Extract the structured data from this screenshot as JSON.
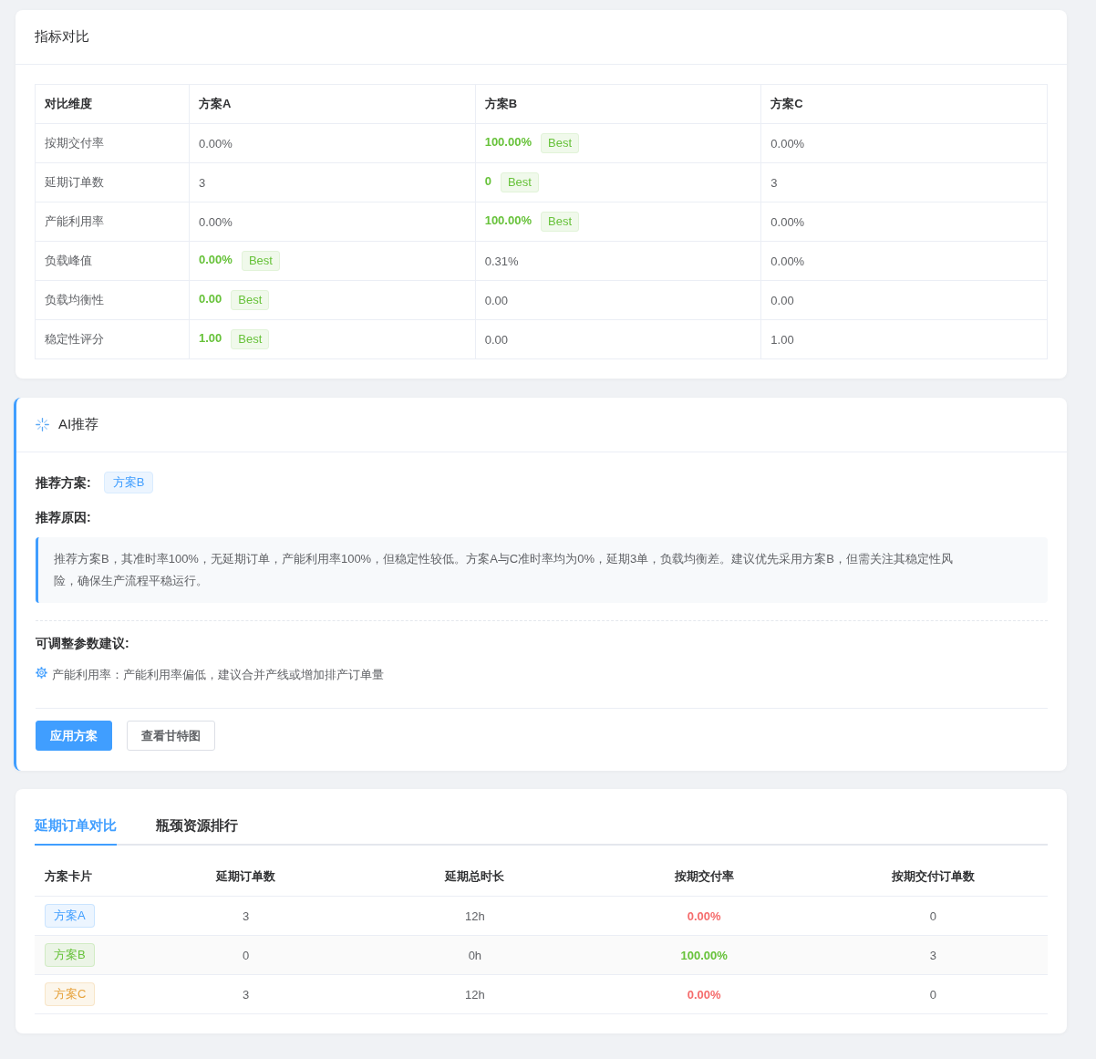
{
  "metrics": {
    "title": "指标对比",
    "dimension_header": "对比维度",
    "columns": [
      "方案A",
      "方案B",
      "方案C"
    ],
    "rows": [
      {
        "label": "按期交付率",
        "cells": [
          {
            "value": "0.00%",
            "best": false
          },
          {
            "value": "100.00%",
            "best": true,
            "badge": "Best"
          },
          {
            "value": "0.00%",
            "best": false
          }
        ]
      },
      {
        "label": "延期订单数",
        "cells": [
          {
            "value": "3",
            "best": false
          },
          {
            "value": "0",
            "best": true,
            "badge": "Best"
          },
          {
            "value": "3",
            "best": false
          }
        ]
      },
      {
        "label": "产能利用率",
        "cells": [
          {
            "value": "0.00%",
            "best": false
          },
          {
            "value": "100.00%",
            "best": true,
            "badge": "Best"
          },
          {
            "value": "0.00%",
            "best": false
          }
        ]
      },
      {
        "label": "负载峰值",
        "cells": [
          {
            "value": "0.00%",
            "best": true,
            "badge": "Best"
          },
          {
            "value": "0.31%",
            "best": false
          },
          {
            "value": "0.00%",
            "best": false
          }
        ]
      },
      {
        "label": "负载均衡性",
        "cells": [
          {
            "value": "0.00",
            "best": true,
            "badge": "Best"
          },
          {
            "value": "0.00",
            "best": false
          },
          {
            "value": "0.00",
            "best": false
          }
        ]
      },
      {
        "label": "稳定性评分",
        "cells": [
          {
            "value": "1.00",
            "best": true,
            "badge": "Best"
          },
          {
            "value": "0.00",
            "best": false
          },
          {
            "value": "1.00",
            "best": false
          }
        ]
      }
    ]
  },
  "ai_recommendation": {
    "title": "AI推荐",
    "recommended_label": "推荐方案:",
    "recommended_plan": "方案B",
    "reason_label": "推荐原因:",
    "reason": "推荐方案B，其准时率100%，无延期订单，产能利用率100%，但稳定性较低。方案A与C准时率均为0%，延期3单，负载均衡差。建议优先采用方案B，但需关注其稳定性风险，确保生产流程平稳运行。",
    "params_label": "可调整参数建议:",
    "params": [
      {
        "text": "产能利用率：产能利用率偏低，建议合并产线或增加排产订单量"
      }
    ],
    "buttons": [
      {
        "label": "应用方案",
        "kind": "primary"
      },
      {
        "label": "查看甘特图",
        "kind": "default"
      }
    ]
  },
  "delay_comparison": {
    "tabs": [
      {
        "label": "延期订单对比",
        "selected": true
      },
      {
        "label": "瓶颈资源排行",
        "selected": false
      }
    ],
    "columns": [
      "方案卡片",
      "延期订单数",
      "延期总时长",
      "按期交付率",
      "按期交付订单数"
    ],
    "rows": [
      {
        "plan": "方案A",
        "color": "#409eff",
        "delayed_orders": "3",
        "delay_total": "12h",
        "on_time_rate": "0.00%",
        "rate_ok": false,
        "on_time_orders": "0"
      },
      {
        "plan": "方案B",
        "color": "#67c23a",
        "delayed_orders": "0",
        "delay_total": "0h",
        "on_time_rate": "100.00%",
        "rate_ok": true,
        "on_time_orders": "3"
      },
      {
        "plan": "方案C",
        "color": "#e6a23c",
        "delayed_orders": "3",
        "delay_total": "12h",
        "on_time_rate": "0.00%",
        "rate_ok": false,
        "on_time_orders": "0"
      }
    ]
  }
}
